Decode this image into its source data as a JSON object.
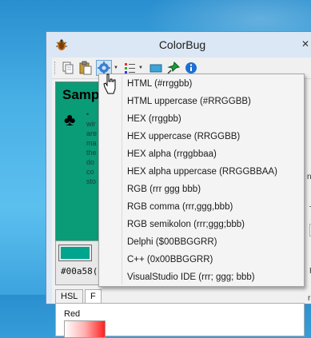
{
  "window": {
    "title": "ColorBug",
    "close_glyph": "✕"
  },
  "toolbar": {
    "buttons": [
      {
        "name": "copy-icon"
      },
      {
        "name": "paste-icon"
      },
      {
        "name": "gear-icon"
      },
      {
        "name": "palette-list-icon"
      },
      {
        "name": "screen-icon"
      },
      {
        "name": "pin-icon"
      },
      {
        "name": "info-icon"
      }
    ]
  },
  "sample": {
    "title": "Samp",
    "club_glyph": "♣",
    "text_lines": [
      "•",
      "wir",
      "are",
      "ma",
      "the",
      "do",
      "co",
      "sto"
    ],
    "swatch_color": "#00a58e",
    "hex_value": "#00a58("
  },
  "tabs": [
    {
      "label": "HSL"
    },
    {
      "label": "F"
    }
  ],
  "channel": {
    "label": "Red"
  },
  "right_glimpses": [
    "n",
    "T",
    "F",
    "rso"
  ],
  "menu": {
    "items": [
      {
        "label": "HTML (#rrggbb)"
      },
      {
        "label": "HTML uppercase (#RRGGBB)"
      },
      {
        "label": "HEX (rrggbb)"
      },
      {
        "label": "HEX uppercase (RRGGBB)"
      },
      {
        "label": "HEX alpha (rrggbbaa)"
      },
      {
        "label": "HEX alpha uppercase (RRGGBBAA)"
      },
      {
        "label": "RGB (rrr ggg bbb)"
      },
      {
        "label": "RGB comma (rrr,ggg,bbb)"
      },
      {
        "label": "RGB semikolon (rrr;ggg;bbb)"
      },
      {
        "label": "Delphi ($00BBGGRR)"
      },
      {
        "label": "C++ (0x00BBGGRR)"
      },
      {
        "label": "VisualStudio IDE (rrr; ggg; bbb)"
      }
    ]
  },
  "colors": {
    "sample_bg": "#0a9b77",
    "desktop": "#49b0e6",
    "window_frame": "#dbe7f4"
  }
}
